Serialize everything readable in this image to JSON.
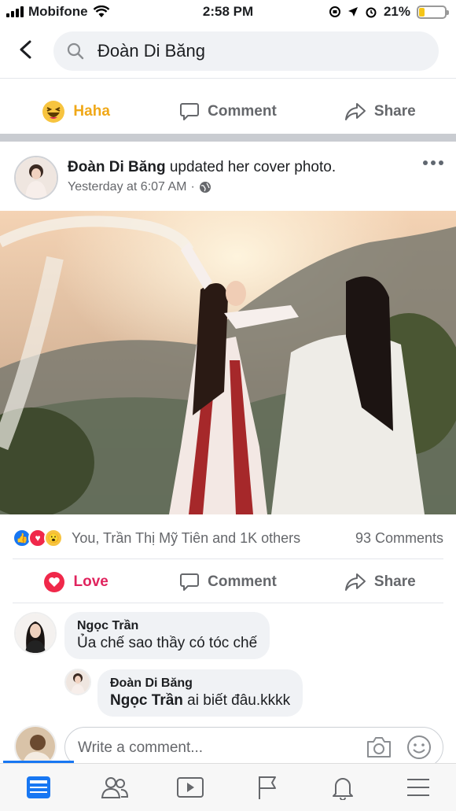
{
  "status": {
    "carrier": "Mobifone",
    "time": "2:58 PM",
    "battery": "21%",
    "battery_level": 0.21
  },
  "search": {
    "query": "Đoàn Di Băng"
  },
  "prev_post_actions": {
    "haha": "Haha",
    "comment": "Comment",
    "share": "Share"
  },
  "post": {
    "author": "Đoàn Di Băng",
    "action": "updated her cover photo.",
    "time": "Yesterday at 6:07 AM",
    "dot": "·",
    "reactions_text": "You, Trần Thị Mỹ Tiên and 1K others",
    "comments_count": "93 Comments",
    "actions": {
      "love": "Love",
      "comment": "Comment",
      "share": "Share"
    }
  },
  "comments": [
    {
      "name": "Ngọc Trần",
      "text": "Ủa chế sao thầy có tóc chế"
    },
    {
      "name": "Đoàn Di Băng",
      "mention": "Ngọc Trần",
      "text": " ai biết đâu.kkkk"
    }
  ],
  "write_comment": {
    "placeholder": "Write a comment..."
  },
  "colors": {
    "accent": "#1877f2",
    "love": "#e0245e",
    "haha": "#f0a818",
    "separator": "#c9ccd1"
  },
  "tabs": [
    "news-feed-icon",
    "friends-icon",
    "watch-icon",
    "pages-icon",
    "notifications-icon",
    "menu-icon"
  ]
}
